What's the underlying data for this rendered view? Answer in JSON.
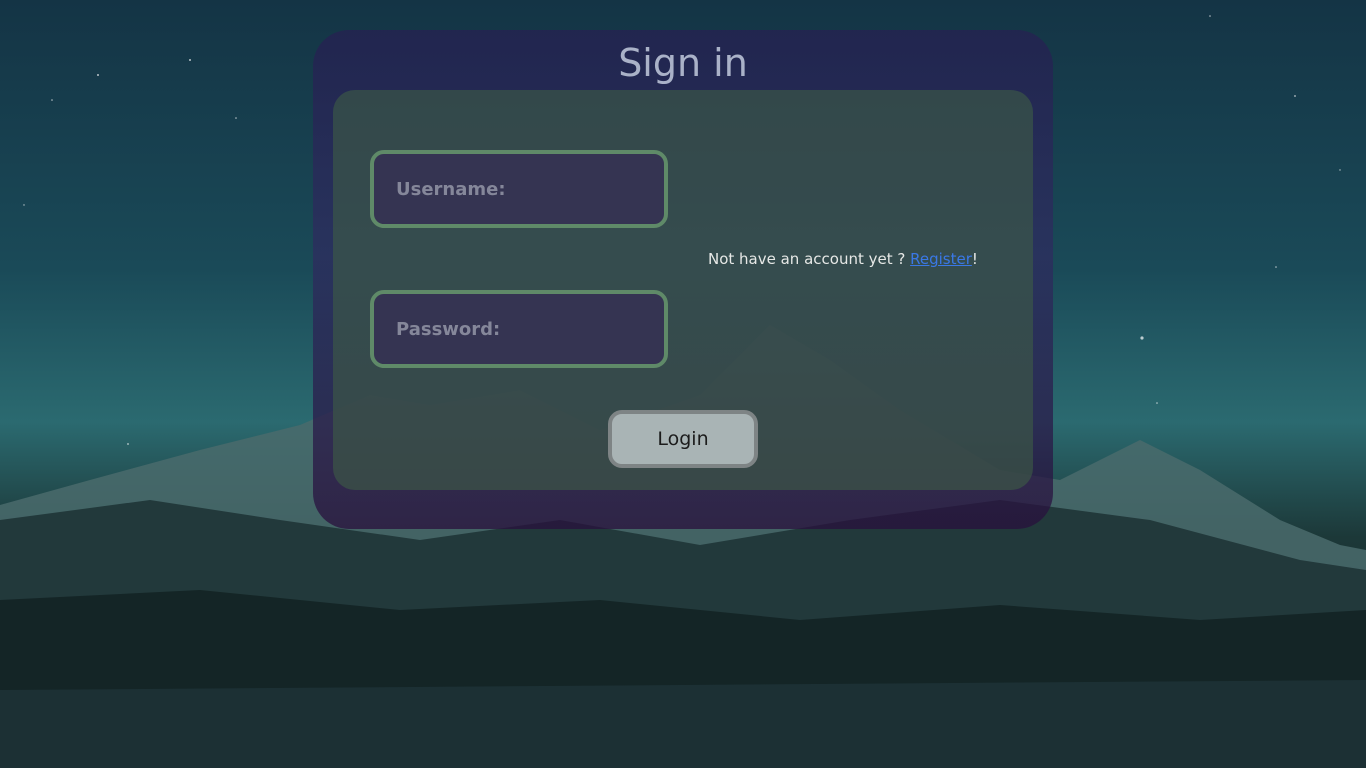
{
  "page": {
    "title": "Sign in"
  },
  "form": {
    "username_placeholder": "Username:",
    "password_placeholder": "Password:",
    "register_prompt": "Not have an account yet ? ",
    "register_link": "Register",
    "register_suffix": "!",
    "login_label": "Login"
  },
  "colors": {
    "card_outer": "#2a2a5c",
    "card_inner": "#3e5c46",
    "field_border": "#5f8a68",
    "field_bg": "#353452",
    "link": "#3a78e6",
    "button_bg": "#a9b4b5"
  }
}
